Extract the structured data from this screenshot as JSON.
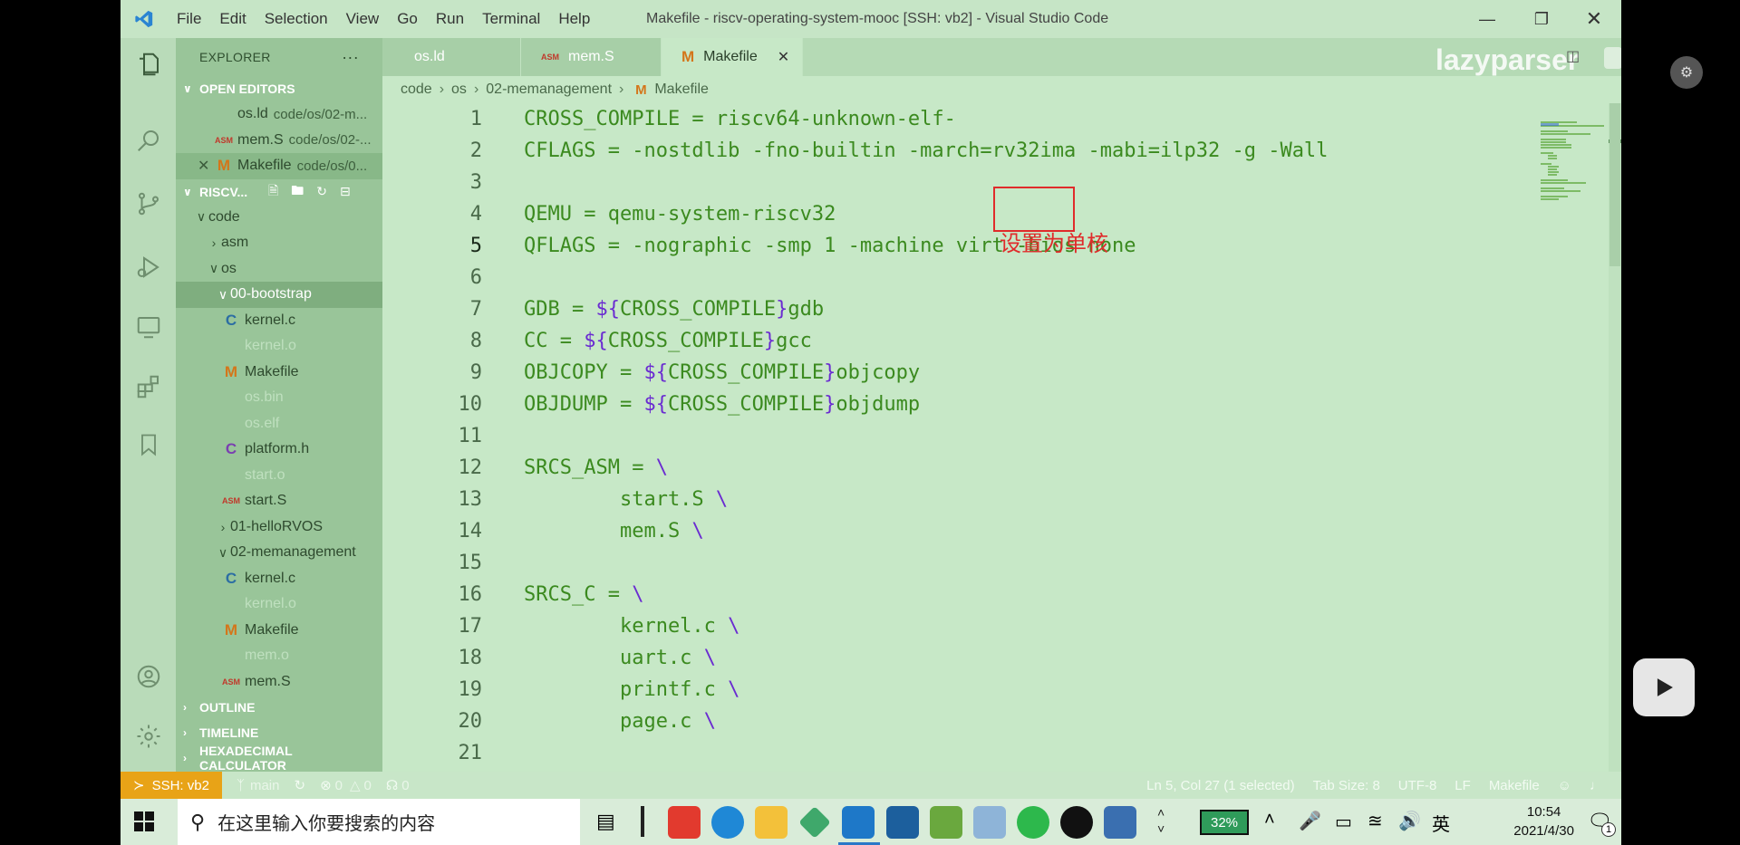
{
  "titlebar": {
    "menu": [
      "File",
      "Edit",
      "Selection",
      "View",
      "Go",
      "Run",
      "Terminal",
      "Help"
    ],
    "title": "Makefile - riscv-operating-system-mooc [SSH: vb2] - Visual Studio Code"
  },
  "explorer": {
    "header": "EXPLORER",
    "more": "···",
    "open_editors_label": "OPEN EDITORS",
    "open_editors": [
      {
        "name": "os.ld",
        "path": "code/os/02-m..."
      },
      {
        "name": "mem.S",
        "path": "code/os/02-..."
      },
      {
        "name": "Makefile",
        "path": "code/os/0..."
      }
    ],
    "workspace_label": "RISCV...",
    "tree": {
      "code": "code",
      "asm": "asm",
      "os": "os",
      "bootstrap": "00-bootstrap",
      "b_files": [
        "kernel.c",
        "kernel.o",
        "Makefile",
        "os.bin",
        "os.elf",
        "platform.h",
        "start.o",
        "start.S"
      ],
      "hello": "01-helloRVOS",
      "memmgmt": "02-memanagement",
      "m_files": [
        "kernel.c",
        "kernel.o",
        "Makefile",
        "mem.o",
        "mem.S"
      ]
    },
    "outline": "OUTLINE",
    "timeline": "TIMELINE",
    "hexcalc": "HEXADECIMAL CALCULATOR"
  },
  "tabs": [
    "os.ld",
    "mem.S",
    "Makefile"
  ],
  "watermark": "lazyparser",
  "breadcrumb": [
    "code",
    "os",
    "02-memanagement",
    "Makefile"
  ],
  "code_lines": [
    {
      "n": "1",
      "t": "CROSS_COMPILE = riscv64-unknown-elf-"
    },
    {
      "n": "2",
      "t": "CFLAGS = -nostdlib -fno-builtin -march=rv32ima -mabi=ilp32 -g -Wall"
    },
    {
      "n": "3",
      "t": ""
    },
    {
      "n": "4",
      "t": "QEMU = qemu-system-riscv32"
    },
    {
      "n": "5",
      "t": "QFLAGS = -nographic -smp 1 -machine virt -bios none"
    },
    {
      "n": "6",
      "t": ""
    },
    {
      "n": "7",
      "t": "GDB = ${CROSS_COMPILE}gdb"
    },
    {
      "n": "8",
      "t": "CC = ${CROSS_COMPILE}gcc"
    },
    {
      "n": "9",
      "t": "OBJCOPY = ${CROSS_COMPILE}objcopy"
    },
    {
      "n": "10",
      "t": "OBJDUMP = ${CROSS_COMPILE}objdump"
    },
    {
      "n": "11",
      "t": ""
    },
    {
      "n": "12",
      "t": "SRCS_ASM = \\"
    },
    {
      "n": "13",
      "t": "        start.S \\"
    },
    {
      "n": "14",
      "t": "        mem.S \\"
    },
    {
      "n": "15",
      "t": ""
    },
    {
      "n": "16",
      "t": "SRCS_C = \\"
    },
    {
      "n": "17",
      "t": "        kernel.c \\"
    },
    {
      "n": "18",
      "t": "        uart.c \\"
    },
    {
      "n": "19",
      "t": "        printf.c \\"
    },
    {
      "n": "20",
      "t": "        page.c \\"
    },
    {
      "n": "21",
      "t": ""
    }
  ],
  "annotation": "设置为单核",
  "status": {
    "ssh": "SSH: vb2",
    "branch": "main",
    "errors": "0",
    "warnings": "0",
    "ports": "0",
    "position": "Ln 5, Col 27 (1 selected)",
    "tabsize": "Tab Size: 8",
    "encoding": "UTF-8",
    "eol": "LF",
    "language": "Makefile"
  },
  "taskbar": {
    "search_placeholder": "在这里输入你要搜索的内容",
    "battery": "32%",
    "ime": "英",
    "time": "10:54",
    "date": "2021/4/30",
    "notif_count": "1"
  },
  "colors": {
    "accent_ssh": "#e8a317",
    "annotation": "#e02b2b",
    "code_text": "#3b8a1f",
    "variable": "#6a2bd1"
  }
}
